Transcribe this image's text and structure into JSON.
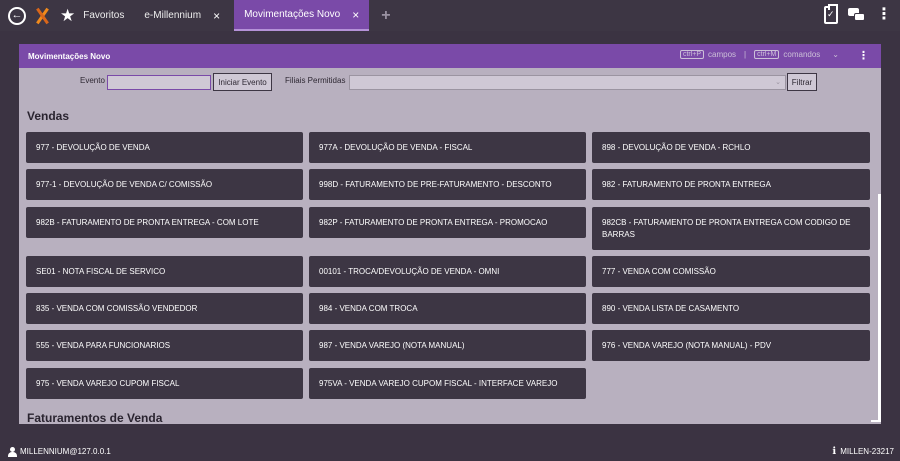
{
  "topbar": {
    "tabs": [
      {
        "label": "Favoritos"
      },
      {
        "label": "e-Millennium"
      },
      {
        "label": "Movimentações Novo"
      }
    ],
    "close_glyph": "×",
    "add_glyph": "+"
  },
  "window": {
    "title": "Movimentações Novo",
    "shortcuts": {
      "key1": "ctrl+P",
      "label1": "campos",
      "separator": "|",
      "key2": "ctrl+M",
      "label2": "comandos"
    }
  },
  "filters": {
    "evento_label": "Evento",
    "evento_value": "",
    "iniciar_button": "Iniciar Evento",
    "filiais_label": "Filiais Permitidas",
    "filiais_value": "",
    "filtrar_button": "Filtrar"
  },
  "sections": [
    {
      "title": "Vendas",
      "items": [
        "977 - DEVOLUÇÃO DE VENDA",
        "977A - DEVOLUÇÃO DE VENDA - FISCAL",
        "898 - DEVOLUÇÃO DE VENDA - RCHLO",
        "977-1 - DEVOLUÇÃO DE VENDA C/ COMISSÃO",
        "998D - FATURAMENTO DE PRE-FATURAMENTO - DESCONTO",
        "982 - FATURAMENTO DE PRONTA ENTREGA",
        "982B - FATURAMENTO DE PRONTA ENTREGA - COM LOTE",
        "982P - FATURAMENTO DE PRONTA ENTREGA - PROMOCAO",
        "982CB - FATURAMENTO DE PRONTA ENTREGA COM CODIGO DE BARRAS",
        "SE01 - NOTA FISCAL DE SERVICO",
        "00101 - TROCA/DEVOLUÇÃO DE VENDA - OMNI",
        "777 - VENDA COM COMISSÃO",
        "835 - VENDA COM COMISSÃO VENDEDOR",
        "984 - VENDA COM TROCA",
        "890 - VENDA LISTA DE CASAMENTO",
        "555 - VENDA PARA FUNCIONARIOS",
        "987 - VENDA VAREJO (NOTA MANUAL)",
        "976 - VENDA VAREJO (NOTA MANUAL) - PDV",
        "975 - VENDA VAREJO CUPOM FISCAL",
        "975VA - VENDA VAREJO CUPOM FISCAL - INTERFACE VAREJO"
      ]
    },
    {
      "title": "Faturamentos de Venda"
    }
  ],
  "statusbar": {
    "user": "MILLENNIUM@127.0.0.1",
    "machine": "MILLEN-23217"
  }
}
